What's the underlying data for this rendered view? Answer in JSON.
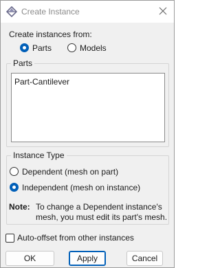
{
  "window": {
    "title": "Create Instance",
    "icon": "abaqus-app-icon",
    "close_icon": "close-icon"
  },
  "create_from": {
    "label": "Create instances from:",
    "options": [
      {
        "label": "Parts",
        "checked": true
      },
      {
        "label": "Models",
        "checked": false
      }
    ]
  },
  "parts": {
    "group_title": "Parts",
    "items": [
      "Part-Cantilever"
    ]
  },
  "instance_type": {
    "group_title": "Instance Type",
    "options": [
      {
        "label": "Dependent (mesh on part)",
        "checked": false
      },
      {
        "label": "Independent (mesh on instance)",
        "checked": true
      }
    ],
    "note_label": "Note:",
    "note_line1": "To change a Dependent instance's",
    "note_line2": "mesh, you must edit its part's mesh."
  },
  "auto_offset": {
    "label": "Auto-offset from other instances",
    "checked": false
  },
  "buttons": {
    "ok": "OK",
    "apply": "Apply",
    "cancel": "Cancel"
  },
  "colors": {
    "accent": "#005fb8",
    "window_bg": "#f0f0f0"
  }
}
